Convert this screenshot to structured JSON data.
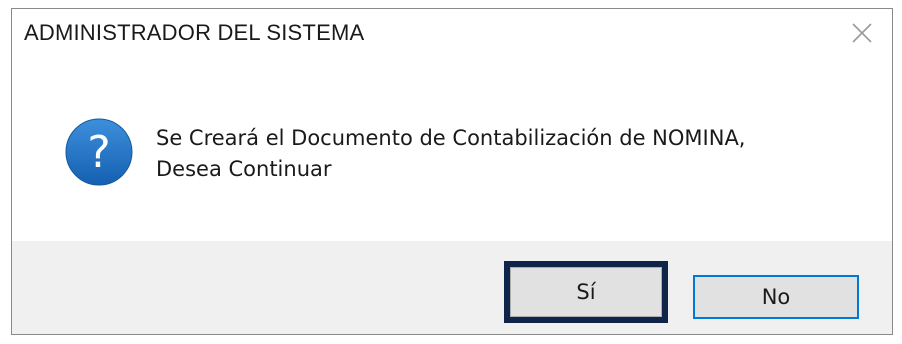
{
  "dialog": {
    "title": "ADMINISTRADOR DEL SISTEMA",
    "close_icon": "close-icon",
    "icon": "question-icon",
    "icon_glyph": "?",
    "message_line1": "Se Creará el Documento de Contabilización de NOMINA,",
    "message_line2": "Desea Continuar",
    "buttons": {
      "yes_label": "Sí",
      "no_label": "No"
    }
  },
  "colors": {
    "icon_blue": "#1e74c8",
    "highlight_border": "#102449",
    "focus_border": "#0078d7",
    "footer_bg": "#f0f0f0",
    "button_bg": "#e1e1e1"
  }
}
